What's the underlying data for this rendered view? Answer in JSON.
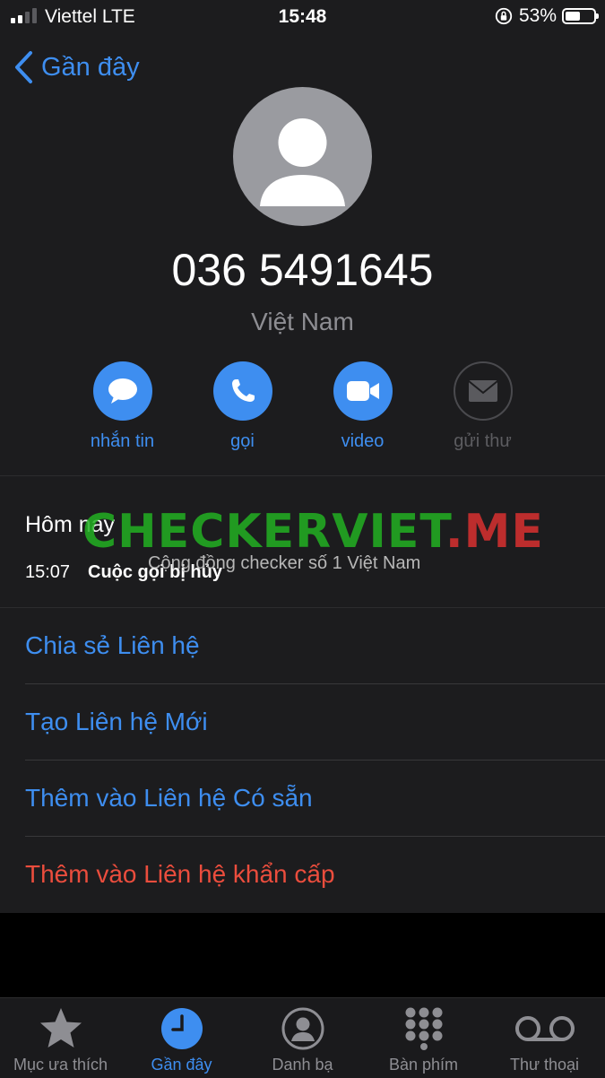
{
  "status_bar": {
    "carrier": "Viettel  LTE",
    "time": "15:48",
    "battery": "53%",
    "battery_level": 0.53
  },
  "nav": {
    "back_label": "Gần đây"
  },
  "contact": {
    "number": "036 5491645",
    "country": "Việt Nam"
  },
  "actions": [
    {
      "label": "nhắn tin",
      "icon": "message-icon",
      "enabled": true
    },
    {
      "label": "gọi",
      "icon": "phone-icon",
      "enabled": true
    },
    {
      "label": "video",
      "icon": "video-icon",
      "enabled": true
    },
    {
      "label": "gửi thư",
      "icon": "mail-icon",
      "enabled": false
    }
  ],
  "history": {
    "title": "Hôm nay",
    "time": "15:07",
    "description": "Cuộc gọi bị hủy"
  },
  "watermark": {
    "brand": "CHECKERVIET",
    "domain": ".ME",
    "tagline": "Cộng đồng checker số 1 Việt Nam"
  },
  "options": [
    {
      "label": "Chia sẻ Liên hệ",
      "color": "#3e8ef0"
    },
    {
      "label": "Tạo Liên hệ Mới",
      "color": "#3e8ef0"
    },
    {
      "label": "Thêm vào Liên hệ Có sẵn",
      "color": "#3e8ef0"
    },
    {
      "label": "Thêm vào Liên hệ khẩn cấp",
      "color": "#eb4d3d"
    }
  ],
  "tabs": [
    {
      "label": "Mục ưa thích",
      "icon": "star-icon",
      "active": false
    },
    {
      "label": "Gần đây",
      "icon": "clock-icon",
      "active": true
    },
    {
      "label": "Danh bạ",
      "icon": "contacts-icon",
      "active": false
    },
    {
      "label": "Bàn phím",
      "icon": "keypad-icon",
      "active": false
    },
    {
      "label": "Thư thoại",
      "icon": "voicemail-icon",
      "active": false
    }
  ],
  "colors": {
    "accent": "#3e8ef0",
    "destructive": "#eb4d3d",
    "background": "#1c1c1e"
  }
}
